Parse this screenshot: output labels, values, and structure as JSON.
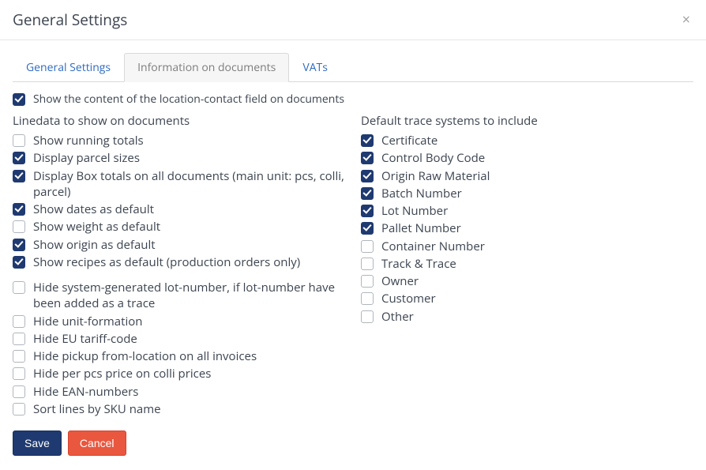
{
  "modal": {
    "title": "General Settings",
    "close": "×"
  },
  "tabs": [
    {
      "id": "general",
      "label": "General Settings",
      "active": false
    },
    {
      "id": "info",
      "label": "Information on documents",
      "active": true
    },
    {
      "id": "vats",
      "label": "VATs",
      "active": false
    }
  ],
  "topOption": {
    "label": "Show the content of the location-contact field on documents",
    "checked": true
  },
  "left": {
    "title": "Linedata to show on documents",
    "groups": [
      [
        {
          "label": "Show running totals",
          "checked": false
        },
        {
          "label": "Display parcel sizes",
          "checked": true
        },
        {
          "label": "Display Box totals on all documents (main unit: pcs, colli, parcel)",
          "checked": true
        },
        {
          "label": "Show dates as default",
          "checked": true
        },
        {
          "label": "Show weight as default",
          "checked": false
        },
        {
          "label": "Show origin as default",
          "checked": true
        },
        {
          "label": "Show recipes as default (production orders only)",
          "checked": true
        }
      ],
      [
        {
          "label": "Hide system-generated lot-number, if lot-number have been added as a trace",
          "checked": false
        },
        {
          "label": "Hide unit-formation",
          "checked": false
        },
        {
          "label": "Hide EU tariff-code",
          "checked": false
        },
        {
          "label": "Hide pickup from-location on all invoices",
          "checked": false
        },
        {
          "label": "Hide per pcs price on colli prices",
          "checked": false
        },
        {
          "label": "Hide EAN-numbers",
          "checked": false
        },
        {
          "label": "Sort lines by SKU name",
          "checked": false
        }
      ]
    ]
  },
  "right": {
    "title": "Default trace systems to include",
    "items": [
      {
        "label": "Certificate",
        "checked": true
      },
      {
        "label": "Control Body Code",
        "checked": true
      },
      {
        "label": "Origin Raw Material",
        "checked": true
      },
      {
        "label": "Batch Number",
        "checked": true
      },
      {
        "label": "Lot Number",
        "checked": true
      },
      {
        "label": "Pallet Number",
        "checked": true
      },
      {
        "label": "Container Number",
        "checked": false
      },
      {
        "label": "Track & Trace",
        "checked": false
      },
      {
        "label": "Owner",
        "checked": false
      },
      {
        "label": "Customer",
        "checked": false
      },
      {
        "label": "Other",
        "checked": false
      }
    ]
  },
  "buttons": {
    "save": "Save",
    "cancel": "Cancel"
  }
}
